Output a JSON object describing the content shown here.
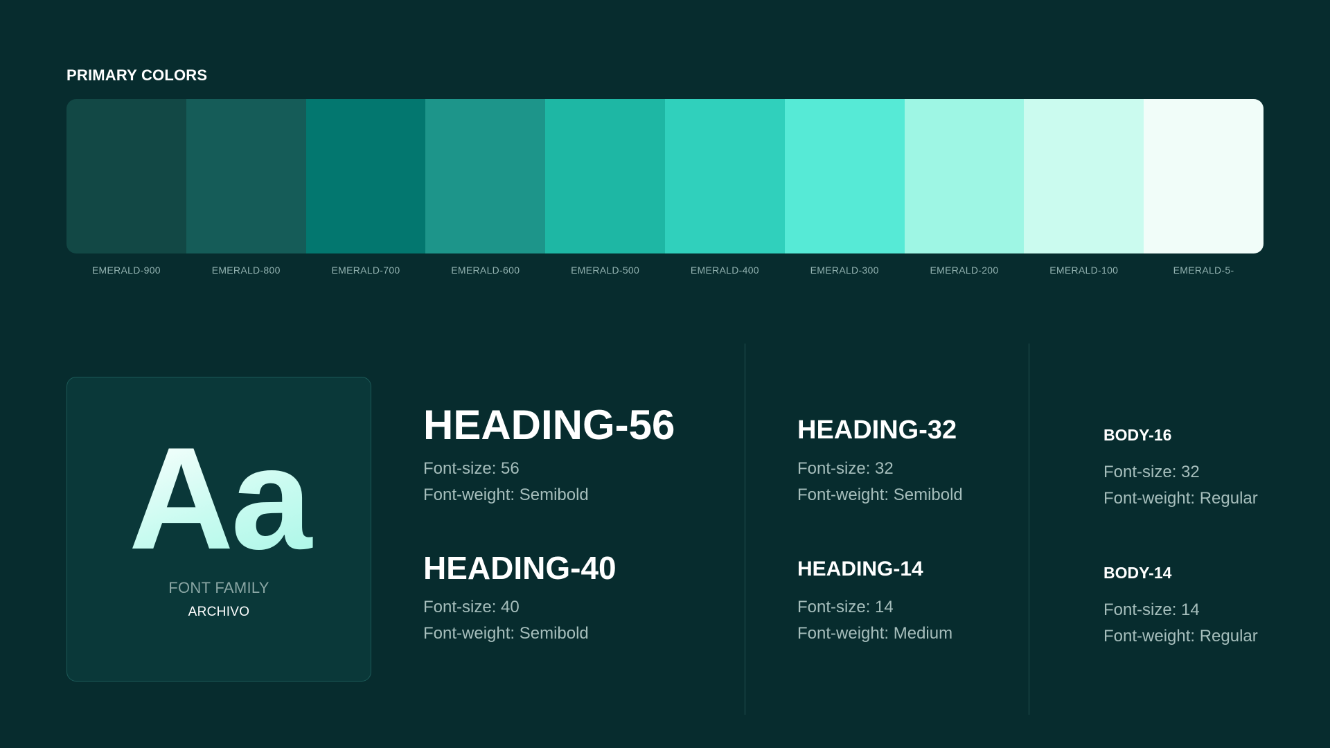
{
  "palette": {
    "title": "PRIMARY COLORS",
    "swatches": [
      {
        "label": "EMERALD-900",
        "color": "#124845"
      },
      {
        "label": "EMERALD-800",
        "color": "#155c58"
      },
      {
        "label": "EMERALD-700",
        "color": "#03776f"
      },
      {
        "label": "EMERALD-600",
        "color": "#1d958a"
      },
      {
        "label": "EMERALD-500",
        "color": "#1eb7a4"
      },
      {
        "label": "EMERALD-400",
        "color": "#30d0bc"
      },
      {
        "label": "EMERALD-300",
        "color": "#56ead6"
      },
      {
        "label": "EMERALD-200",
        "color": "#9ef6e4"
      },
      {
        "label": "EMERALD-100",
        "color": "#cbfbef"
      },
      {
        "label": "EMERALD-5-",
        "color": "#f1fdf9"
      }
    ]
  },
  "font_family": {
    "sample": "Aa",
    "label": "FONT FAMILY",
    "value": "ARCHIVO"
  },
  "typography": {
    "heading56": {
      "name": "HEADING-56",
      "size": "Font-size: 56",
      "weight": "Font-weight: Semibold"
    },
    "heading40": {
      "name": "HEADING-40",
      "size": "Font-size: 40",
      "weight": "Font-weight: Semibold"
    },
    "heading32": {
      "name": "HEADING-32",
      "size": "Font-size: 32",
      "weight": "Font-weight: Semibold"
    },
    "heading14": {
      "name": "HEADING-14",
      "size": "Font-size: 14",
      "weight": "Font-weight: Medium"
    },
    "body16": {
      "name": "BODY-16",
      "size": "Font-size: 32",
      "weight": "Font-weight: Regular"
    },
    "body14": {
      "name": "BODY-14",
      "size": "Font-size: 14",
      "weight": "Font-weight: Regular"
    }
  }
}
